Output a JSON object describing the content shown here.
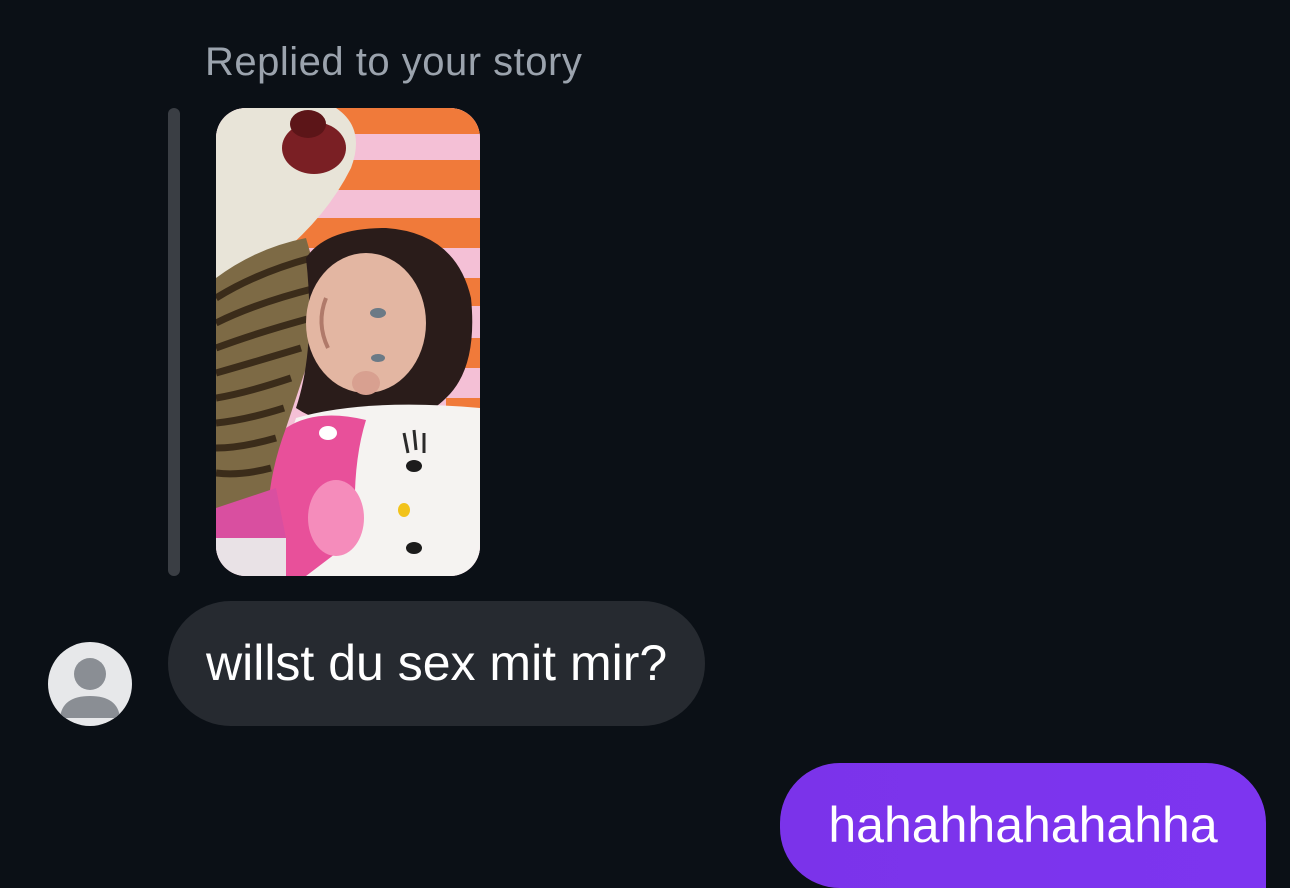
{
  "story_reply": {
    "context_label": "Replied to your story",
    "thumbnail_alt": "story-photo"
  },
  "messages": [
    {
      "direction": "incoming",
      "text": "willst du sex mit mir?"
    },
    {
      "direction": "outgoing",
      "text": "hahahhahahahha"
    }
  ],
  "colors": {
    "background": "#0b1016",
    "incoming_bubble": "#262a30",
    "outgoing_bubble": "#7b33ea",
    "context_text": "#9ba3ad",
    "reply_bar": "#3a3e44"
  },
  "icons": {
    "avatar": "default-avatar-icon"
  }
}
